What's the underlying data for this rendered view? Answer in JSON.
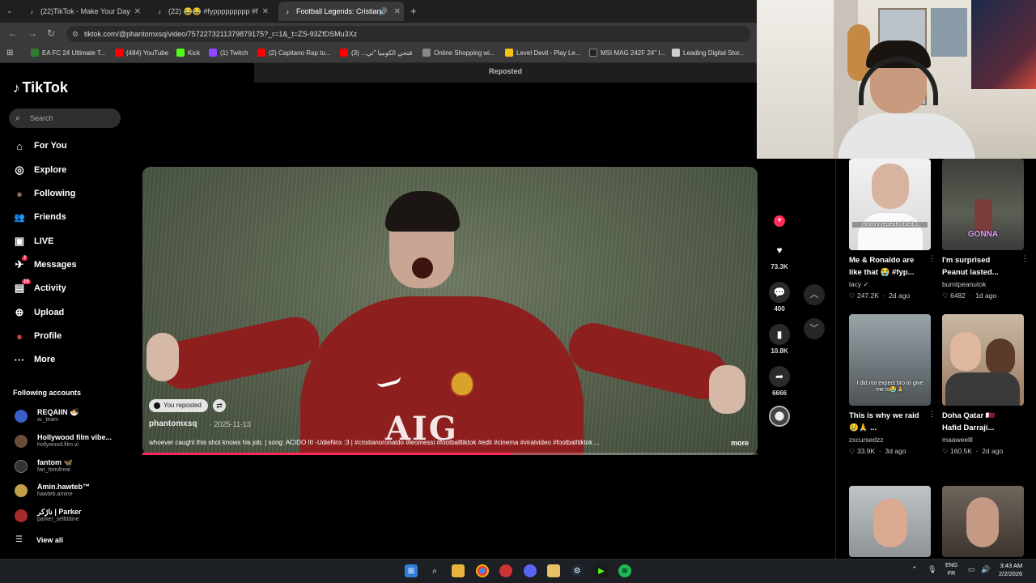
{
  "browser": {
    "tabs": [
      {
        "label": "(22)TikTok - Make Your Day",
        "active": false
      },
      {
        "label": "(22) 😂😂 #fyppppppppp #f",
        "active": false
      },
      {
        "label": "Football Legends: Cristiano",
        "active": true
      }
    ],
    "new_tab": "+",
    "url": "tiktok.com/@phantomxsq/video/7572273211379879175?_r=1&_t=ZS-93ZfDSMu3Xz",
    "bookmarks": [
      {
        "label": "EA FC 24 Ultimate T...",
        "color": "#2e7d32"
      },
      {
        "label": "(484) YouTube",
        "color": "#ff0000"
      },
      {
        "label": "Kick",
        "color": "#53fc18"
      },
      {
        "label": "(1) Twitch",
        "color": "#9146ff"
      },
      {
        "label": "(2) Capitano Rap tu...",
        "color": "#ff0000"
      },
      {
        "label": "قتحي الكوميا \"تي... (3)",
        "color": "#ff0000"
      },
      {
        "label": "Online Shopping wi...",
        "color": "#888888"
      },
      {
        "label": "Level Devil - Play Le...",
        "color": "#f5c518"
      },
      {
        "label": "MSI MAG 242F 24\" I...",
        "color": "#222222"
      },
      {
        "label": "Leading Digital Stor...",
        "color": "#cccccc"
      }
    ]
  },
  "sidebar": {
    "logo": "TikTok",
    "search_placeholder": "Search",
    "items": [
      {
        "label": "For You",
        "icon": "home-icon",
        "glyph": "⌂"
      },
      {
        "label": "Explore",
        "icon": "compass-icon",
        "glyph": "◎"
      },
      {
        "label": "Following",
        "icon": "avatar-icon",
        "glyph": "●"
      },
      {
        "label": "Friends",
        "icon": "friends-icon",
        "glyph": "👥"
      },
      {
        "label": "LIVE",
        "icon": "live-icon",
        "glyph": "▣"
      },
      {
        "label": "Messages",
        "icon": "messages-icon",
        "glyph": "✈",
        "badge": "7"
      },
      {
        "label": "Activity",
        "icon": "activity-icon",
        "glyph": "▤",
        "badge": "15"
      },
      {
        "label": "Upload",
        "icon": "upload-icon",
        "glyph": "⊕"
      },
      {
        "label": "Profile",
        "icon": "profile-icon",
        "glyph": "●"
      },
      {
        "label": "More",
        "icon": "more-icon",
        "glyph": "···"
      }
    ],
    "following_title": "Following accounts",
    "accounts": [
      {
        "name": "REQAIIN 🍜",
        "handle": "w._team",
        "color": "#3a5fcd"
      },
      {
        "name": "Hollywood film vibe...",
        "handle": "hollywood.film.vi",
        "color": "#6b4c3b"
      },
      {
        "name": "fantom 🦋",
        "handle": "fan_tom4real",
        "color": "#222222"
      },
      {
        "name": "Amin.hawteb™",
        "handle": "hawteb.amine",
        "color": "#c2a04a"
      },
      {
        "name": "ناژکر | Parker",
        "handle": "parker_selfddine",
        "color": "#a52a2a"
      }
    ],
    "view_all": "View all"
  },
  "reposted_label": "Reposted",
  "video": {
    "pill": "You reposted",
    "author": "phantomxsq",
    "date": "· 2025-11-13",
    "sponsor_text": "AIG",
    "caption": "whoever caught this shot knows his job. | song: ACIDO III -UdieNnx :3 | #cristianoronaldo #leomessi #footballtiktok #edit #cinema #viralvideo #footballtiktok ...",
    "more": "more",
    "progress": 0.6
  },
  "actions": {
    "likes": "73.3K",
    "comments": "400",
    "saves": "10.8K",
    "shares": "6666"
  },
  "recommended": [
    {
      "title": "Me & Ronaldo are like that 😭 #fyp...",
      "author": "lacy ✓",
      "views": "♡ 247.2K",
      "age": "2d ago",
      "thumb_text": "History repeats itself...",
      "bg": "#e8e8e8"
    },
    {
      "title": "I'm surprised Peanut lasted...",
      "author": "burntpeanutok",
      "views": "♡ 6482",
      "age": "1d ago",
      "thumb_text": "GONNA",
      "bg": "#4a4f45"
    },
    {
      "title": "This is why we raid 😢🙏 ...",
      "author": "zxcursedzz",
      "views": "♡ 33.9K",
      "age": "3d ago",
      "thumb_text": "I did not expect bro to give me ts😭🙏",
      "bg": "#7f8a8e"
    },
    {
      "title": "Doha Qatar 🇶🇦 Hafid Darraji...",
      "author": "maaweelll",
      "views": "♡ 160.5K",
      "age": "2d ago",
      "thumb_text": "",
      "bg": "#b88a63"
    },
    {
      "title": "",
      "author": "",
      "views": "",
      "age": "",
      "thumb_text": "",
      "bg": "#9aa2a6"
    },
    {
      "title": "",
      "author": "",
      "views": "",
      "age": "",
      "thumb_text": "",
      "bg": "#5a4f46"
    }
  ],
  "taskbar": {
    "lang": "ENG",
    "lang2": "FR",
    "time": "3:43 AM",
    "date": "2/2/2026"
  }
}
